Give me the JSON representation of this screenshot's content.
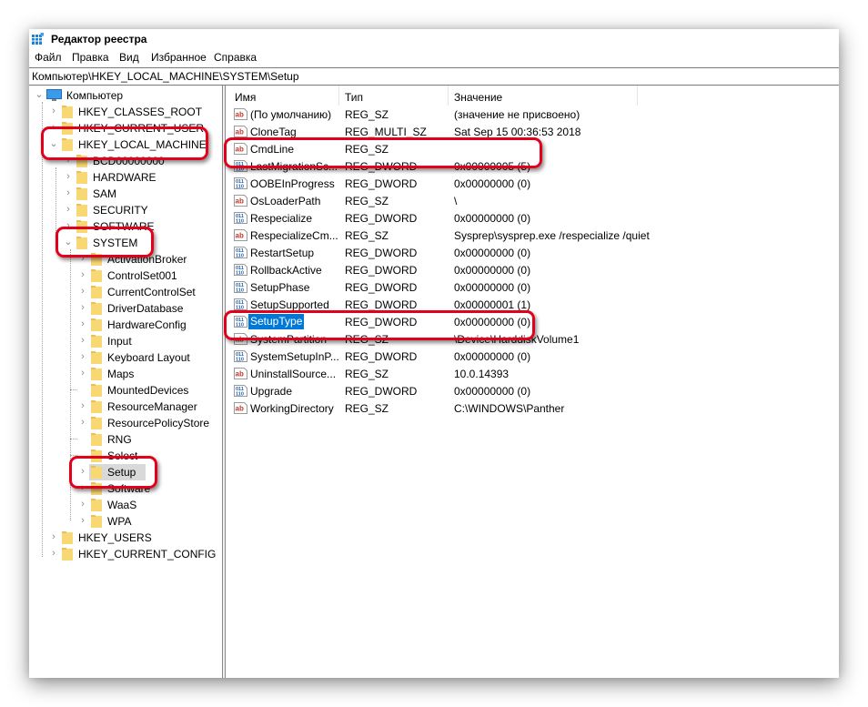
{
  "window": {
    "title": "Редактор реестра",
    "app_icon": "registry-editor-icon"
  },
  "menu": [
    "Файл",
    "Правка",
    "Вид",
    "Избранное",
    "Справка"
  ],
  "address": "Компьютер\\HKEY_LOCAL_MACHINE\\SYSTEM\\Setup",
  "tree": {
    "root": "Компьютер",
    "hives": [
      {
        "label": "HKEY_CLASSES_ROOT",
        "expanded": false
      },
      {
        "label": "HKEY_CURRENT_USER",
        "expanded": false
      },
      {
        "label": "HKEY_LOCAL_MACHINE",
        "expanded": true
      },
      {
        "label": "HKEY_USERS",
        "expanded": false
      },
      {
        "label": "HKEY_CURRENT_CONFIG",
        "expanded": false
      }
    ],
    "hklm_children": [
      "BCD00000000",
      "HARDWARE",
      "SAM",
      "SECURITY",
      "SOFTWARE",
      "SYSTEM"
    ],
    "system_children": [
      {
        "label": "ActivationBroker",
        "has_children": true
      },
      {
        "label": "ControlSet001",
        "has_children": true
      },
      {
        "label": "CurrentControlSet",
        "has_children": true
      },
      {
        "label": "DriverDatabase",
        "has_children": true
      },
      {
        "label": "HardwareConfig",
        "has_children": true
      },
      {
        "label": "Input",
        "has_children": true
      },
      {
        "label": "Keyboard Layout",
        "has_children": true
      },
      {
        "label": "Maps",
        "has_children": true
      },
      {
        "label": "MountedDevices",
        "has_children": false
      },
      {
        "label": "ResourceManager",
        "has_children": true
      },
      {
        "label": "ResourcePolicyStore",
        "has_children": true
      },
      {
        "label": "RNG",
        "has_children": false
      },
      {
        "label": "Select",
        "has_children": false
      },
      {
        "label": "Setup",
        "has_children": true,
        "selected": true
      },
      {
        "label": "Software",
        "has_children": true
      },
      {
        "label": "WaaS",
        "has_children": true
      },
      {
        "label": "WPA",
        "has_children": true
      }
    ]
  },
  "list": {
    "columns": [
      "Имя",
      "Тип",
      "Значение"
    ],
    "rows": [
      {
        "icon": "string-value-icon",
        "name": "(По умолчанию)",
        "type": "REG_SZ",
        "data": "(значение не присвоено)"
      },
      {
        "icon": "string-value-icon",
        "name": "CloneTag",
        "type": "REG_MULTI_SZ",
        "data": "Sat Sep 15 00:36:53 2018"
      },
      {
        "icon": "string-value-icon",
        "name": "CmdLine",
        "type": "REG_SZ",
        "data": ""
      },
      {
        "icon": "binary-value-icon",
        "name": "LastMigrationSc...",
        "type": "REG_DWORD",
        "data": "0x00000005 (5)"
      },
      {
        "icon": "binary-value-icon",
        "name": "OOBEInProgress",
        "type": "REG_DWORD",
        "data": "0x00000000 (0)"
      },
      {
        "icon": "string-value-icon",
        "name": "OsLoaderPath",
        "type": "REG_SZ",
        "data": "\\"
      },
      {
        "icon": "binary-value-icon",
        "name": "Respecialize",
        "type": "REG_DWORD",
        "data": "0x00000000 (0)"
      },
      {
        "icon": "string-value-icon",
        "name": "RespecializeCm...",
        "type": "REG_SZ",
        "data": "Sysprep\\sysprep.exe /respecialize /quiet"
      },
      {
        "icon": "binary-value-icon",
        "name": "RestartSetup",
        "type": "REG_DWORD",
        "data": "0x00000000 (0)"
      },
      {
        "icon": "binary-value-icon",
        "name": "RollbackActive",
        "type": "REG_DWORD",
        "data": "0x00000000 (0)"
      },
      {
        "icon": "binary-value-icon",
        "name": "SetupPhase",
        "type": "REG_DWORD",
        "data": "0x00000000 (0)"
      },
      {
        "icon": "binary-value-icon",
        "name": "SetupSupported",
        "type": "REG_DWORD",
        "data": "0x00000001 (1)"
      },
      {
        "icon": "binary-value-icon",
        "name": "SetupType",
        "type": "REG_DWORD",
        "data": "0x00000000 (0)",
        "selected": true
      },
      {
        "icon": "string-value-icon",
        "name": "SystemPartition",
        "type": "REG_SZ",
        "data": "\\Device\\HarddiskVolume1"
      },
      {
        "icon": "binary-value-icon",
        "name": "SystemSetupInP...",
        "type": "REG_DWORD",
        "data": "0x00000000 (0)"
      },
      {
        "icon": "string-value-icon",
        "name": "UninstallSource...",
        "type": "REG_SZ",
        "data": "10.0.14393"
      },
      {
        "icon": "binary-value-icon",
        "name": "Upgrade",
        "type": "REG_DWORD",
        "data": "0x00000000 (0)"
      },
      {
        "icon": "string-value-icon",
        "name": "WorkingDirectory",
        "type": "REG_SZ",
        "data": "C:\\WINDOWS\\Panther"
      }
    ]
  },
  "colors": {
    "annotation": "#e2001a",
    "selection": "#0078d7",
    "folder": "#f8d775",
    "tree_selected_bg": "#d9d9d9"
  }
}
